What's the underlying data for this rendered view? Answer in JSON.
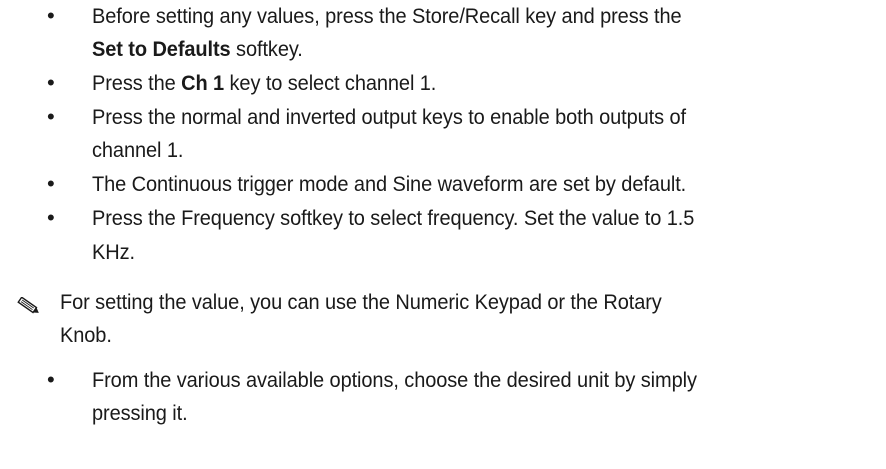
{
  "steps": [
    {
      "lines": [
        [
          "Before setting any values, press the Store/Recall key and press the"
        ],
        [
          {
            "b": "Set to Defaults"
          },
          " softkey."
        ]
      ]
    },
    {
      "lines": [
        [
          "Press the ",
          {
            "b": "Ch 1"
          },
          " key to select channel 1."
        ]
      ]
    },
    {
      "lines": [
        [
          "Press the normal and inverted output keys to enable both outputs of"
        ],
        [
          "channel 1."
        ]
      ]
    },
    {
      "lines": [
        [
          "The Continuous trigger mode and Sine waveform are set by default."
        ]
      ]
    },
    {
      "lines": [
        [
          "Press the Frequency softkey to select frequency. Set the value to 1.5"
        ],
        [
          "KHz."
        ]
      ]
    }
  ],
  "note": {
    "icon": "pencil-note-icon",
    "lines": [
      "For setting the value, you can use the Numeric Keypad or the Rotary",
      "Knob."
    ]
  },
  "final_step": {
    "lines": [
      "From the various available options, choose the desired unit by simply",
      "pressing it."
    ]
  }
}
